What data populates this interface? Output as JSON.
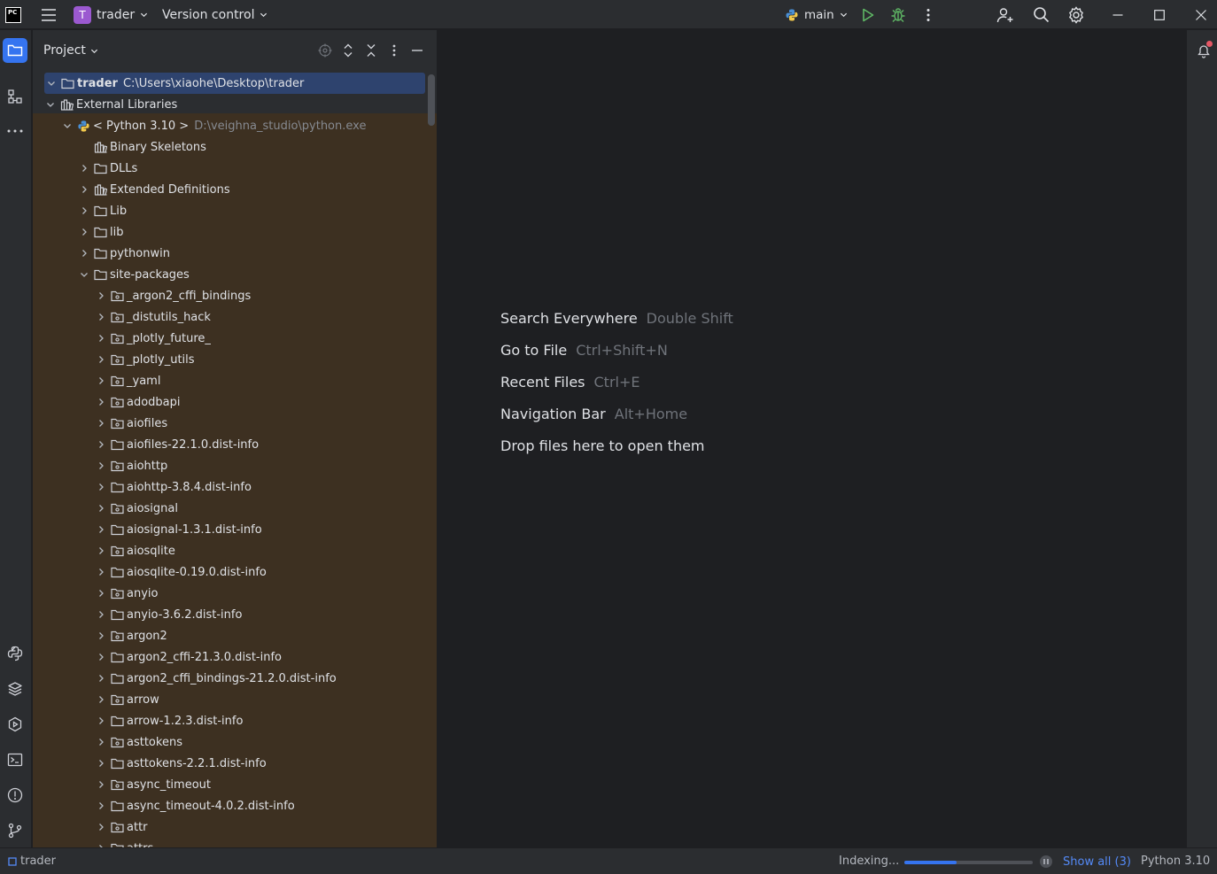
{
  "titlebar": {
    "project_letter": "T",
    "project_name": "trader",
    "vcs_label": "Version control",
    "branch": "main"
  },
  "panel": {
    "title": "Project"
  },
  "tree": [
    {
      "depth": 0,
      "arrow": "down",
      "icon": "folder",
      "label": "trader",
      "bold": true,
      "path": "C:\\Users\\xiaohe\\Desktop\\trader",
      "selected": true
    },
    {
      "depth": 0,
      "arrow": "down",
      "icon": "library",
      "label": "External Libraries"
    },
    {
      "depth": 1,
      "arrow": "down",
      "icon": "python",
      "label": "< Python 3.10 >",
      "dim": "D:\\veighna_studio\\python.exe"
    },
    {
      "depth": 2,
      "arrow": "none",
      "icon": "library",
      "label": "Binary Skeletons"
    },
    {
      "depth": 2,
      "arrow": "right",
      "icon": "folder",
      "label": "DLLs"
    },
    {
      "depth": 2,
      "arrow": "right",
      "icon": "library",
      "label": "Extended Definitions"
    },
    {
      "depth": 2,
      "arrow": "right",
      "icon": "folder",
      "label": "Lib"
    },
    {
      "depth": 2,
      "arrow": "right",
      "icon": "folder",
      "label": "lib"
    },
    {
      "depth": 2,
      "arrow": "right",
      "icon": "folder",
      "label": "pythonwin"
    },
    {
      "depth": 2,
      "arrow": "down",
      "icon": "folder",
      "label": "site-packages"
    },
    {
      "depth": 3,
      "arrow": "right",
      "icon": "package",
      "label": "_argon2_cffi_bindings"
    },
    {
      "depth": 3,
      "arrow": "right",
      "icon": "package",
      "label": "_distutils_hack"
    },
    {
      "depth": 3,
      "arrow": "right",
      "icon": "package",
      "label": "_plotly_future_"
    },
    {
      "depth": 3,
      "arrow": "right",
      "icon": "package",
      "label": "_plotly_utils"
    },
    {
      "depth": 3,
      "arrow": "right",
      "icon": "package",
      "label": "_yaml"
    },
    {
      "depth": 3,
      "arrow": "right",
      "icon": "package",
      "label": "adodbapi"
    },
    {
      "depth": 3,
      "arrow": "right",
      "icon": "package",
      "label": "aiofiles"
    },
    {
      "depth": 3,
      "arrow": "right",
      "icon": "folder",
      "label": "aiofiles-22.1.0.dist-info"
    },
    {
      "depth": 3,
      "arrow": "right",
      "icon": "package",
      "label": "aiohttp"
    },
    {
      "depth": 3,
      "arrow": "right",
      "icon": "folder",
      "label": "aiohttp-3.8.4.dist-info"
    },
    {
      "depth": 3,
      "arrow": "right",
      "icon": "package",
      "label": "aiosignal"
    },
    {
      "depth": 3,
      "arrow": "right",
      "icon": "folder",
      "label": "aiosignal-1.3.1.dist-info"
    },
    {
      "depth": 3,
      "arrow": "right",
      "icon": "package",
      "label": "aiosqlite"
    },
    {
      "depth": 3,
      "arrow": "right",
      "icon": "folder",
      "label": "aiosqlite-0.19.0.dist-info"
    },
    {
      "depth": 3,
      "arrow": "right",
      "icon": "package",
      "label": "anyio"
    },
    {
      "depth": 3,
      "arrow": "right",
      "icon": "folder",
      "label": "anyio-3.6.2.dist-info"
    },
    {
      "depth": 3,
      "arrow": "right",
      "icon": "package",
      "label": "argon2"
    },
    {
      "depth": 3,
      "arrow": "right",
      "icon": "folder",
      "label": "argon2_cffi-21.3.0.dist-info"
    },
    {
      "depth": 3,
      "arrow": "right",
      "icon": "folder",
      "label": "argon2_cffi_bindings-21.2.0.dist-info"
    },
    {
      "depth": 3,
      "arrow": "right",
      "icon": "package",
      "label": "arrow"
    },
    {
      "depth": 3,
      "arrow": "right",
      "icon": "folder",
      "label": "arrow-1.2.3.dist-info"
    },
    {
      "depth": 3,
      "arrow": "right",
      "icon": "package",
      "label": "asttokens"
    },
    {
      "depth": 3,
      "arrow": "right",
      "icon": "folder",
      "label": "asttokens-2.2.1.dist-info"
    },
    {
      "depth": 3,
      "arrow": "right",
      "icon": "package",
      "label": "async_timeout"
    },
    {
      "depth": 3,
      "arrow": "right",
      "icon": "folder",
      "label": "async_timeout-4.0.2.dist-info"
    },
    {
      "depth": 3,
      "arrow": "right",
      "icon": "package",
      "label": "attr"
    },
    {
      "depth": 3,
      "arrow": "right",
      "icon": "package",
      "label": "attrs"
    }
  ],
  "editor": {
    "hints": [
      {
        "label": "Search Everywhere",
        "key": "Double Shift"
      },
      {
        "label": "Go to File",
        "key": "Ctrl+Shift+N"
      },
      {
        "label": "Recent Files",
        "key": "Ctrl+E"
      },
      {
        "label": "Navigation Bar",
        "key": "Alt+Home"
      },
      {
        "label": "Drop files here to open them",
        "key": ""
      }
    ]
  },
  "statusbar": {
    "project": "trader",
    "indexing": "Indexing...",
    "progress_fraction": 0.41,
    "show_all": "Show all (3)",
    "interpreter": "Python 3.10"
  },
  "colors": {
    "accent": "#3574f0",
    "panel_bg": "#2b2d30",
    "editor_bg": "#1e1f22",
    "excluded_bg": "#3d3021",
    "selection": "#2e436e",
    "notification_dot": "#e55765"
  }
}
